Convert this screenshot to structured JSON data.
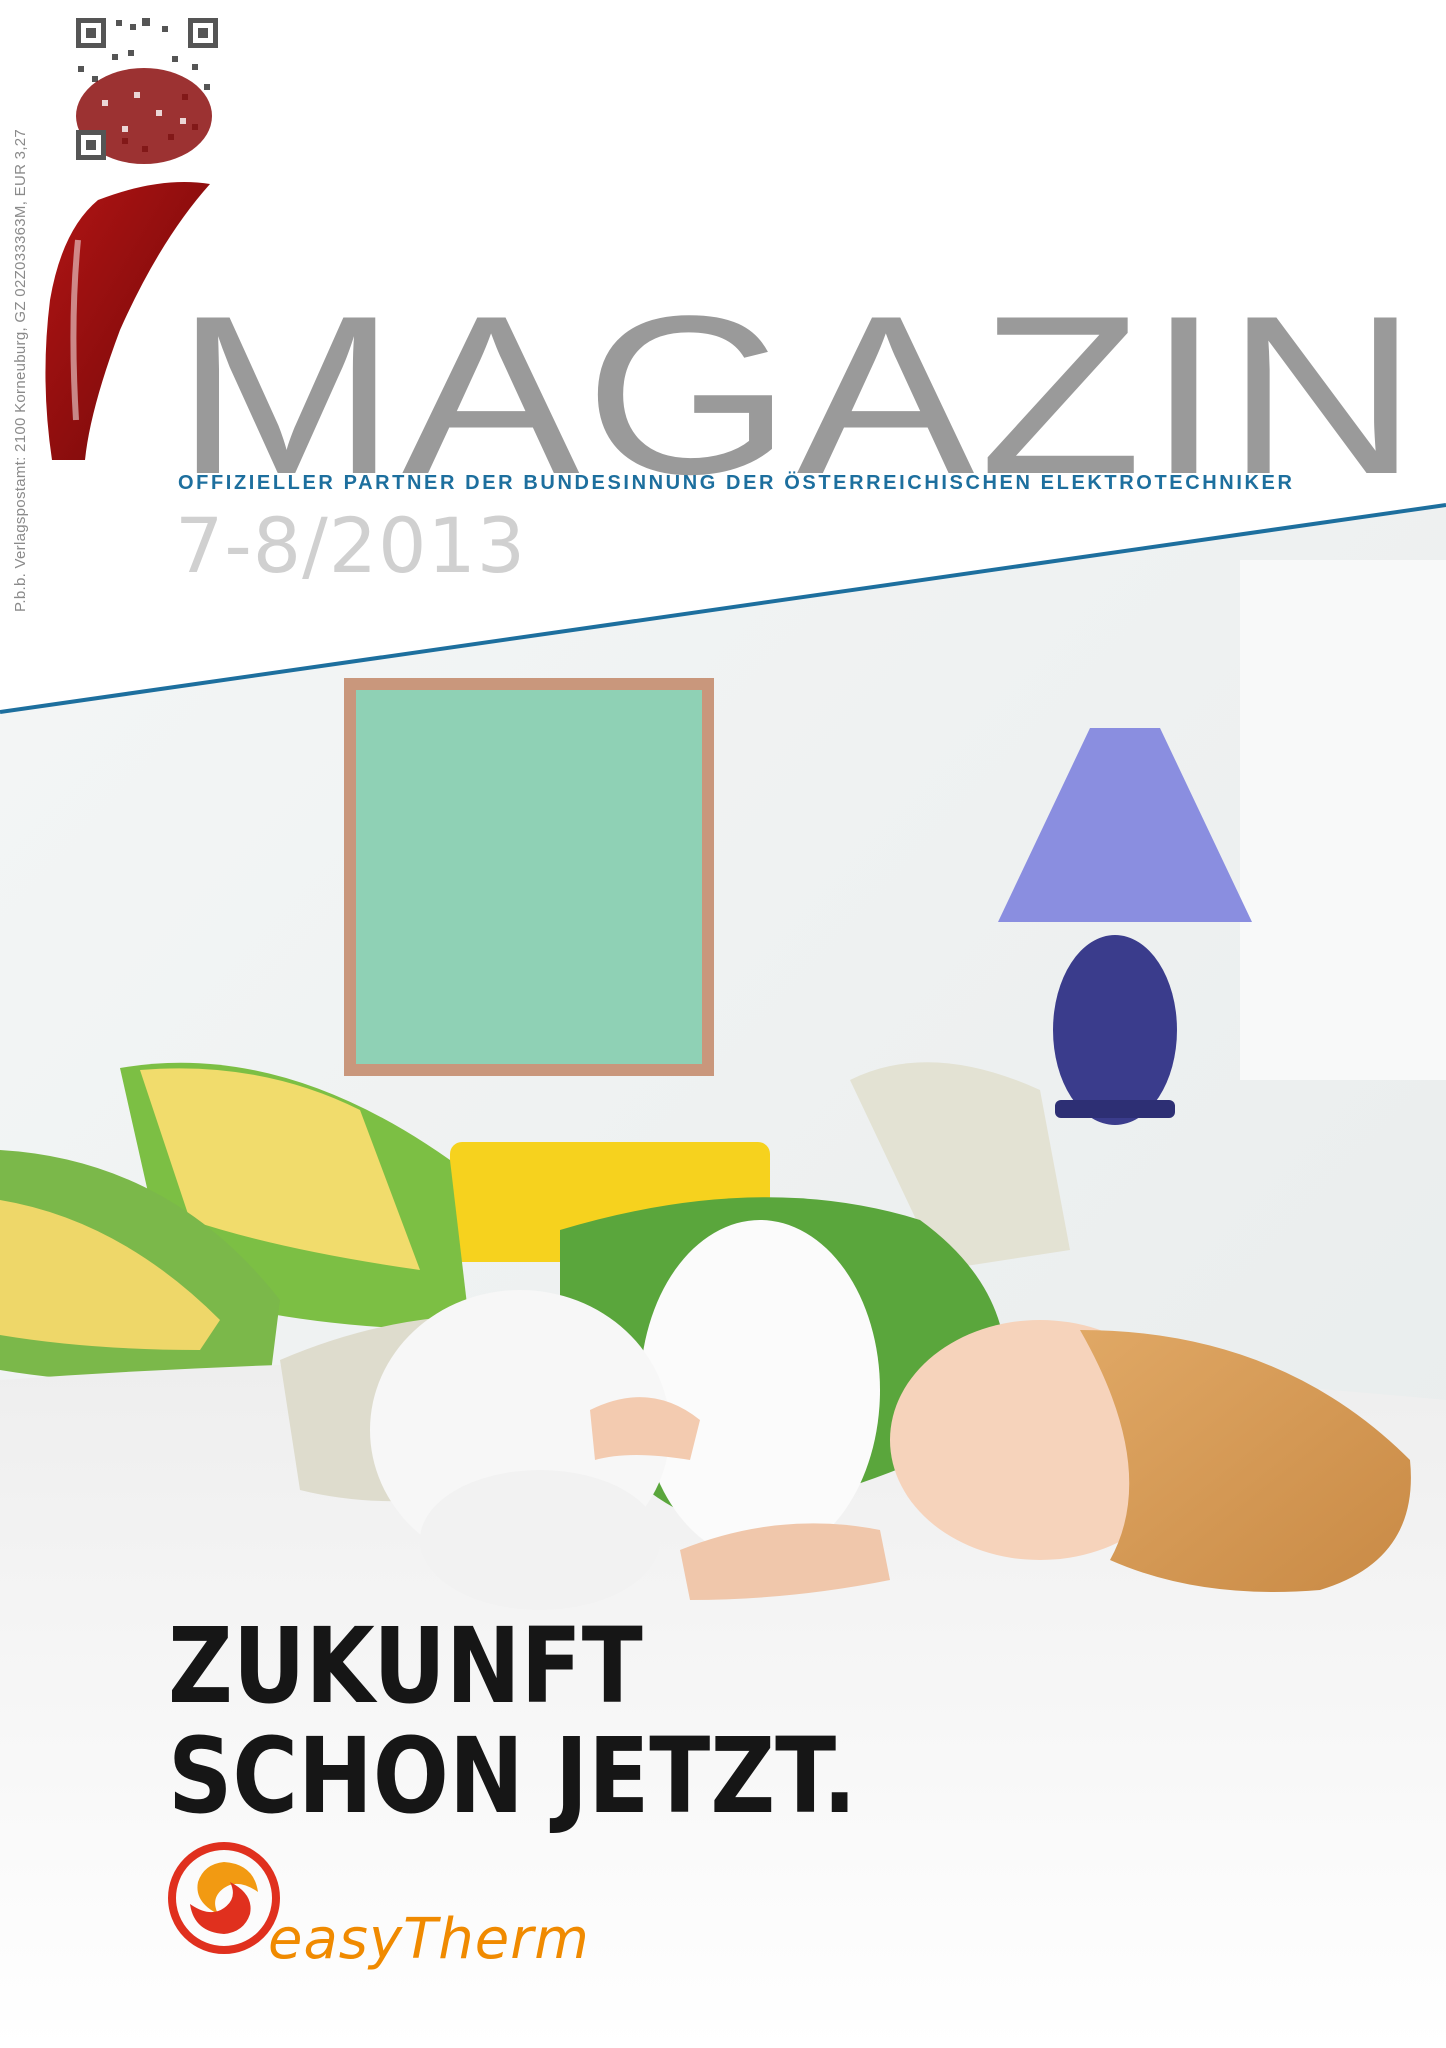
{
  "masthead": {
    "title": "MAGAZIN",
    "subtitle": "OFFIZIELLER PARTNER DER BUNDESINNUNG DER ÖSTERREICHISCHEN ELEKTROTECHNIKER",
    "issue": "7-8/2013"
  },
  "postal_notice": "P.b.b. Verlagspostamt: 2100 Korneuburg, GZ 02Z033363M, EUR 3,27",
  "headline": {
    "line1": "ZUKUNFT",
    "line2": "SCHON JETZT."
  },
  "brand": {
    "name": "easyTherm"
  },
  "colors": {
    "masthead_grey": "#9a9a9a",
    "accent_blue": "#1d6f9e",
    "logo_red": "#8b0e0e",
    "brand_orange": "#f08a00",
    "headline": "#161616"
  },
  "icons": {
    "logo": "i-logo-icon",
    "qr": "qr-code-icon",
    "brand_mark": "easytherm-swirl-icon"
  }
}
